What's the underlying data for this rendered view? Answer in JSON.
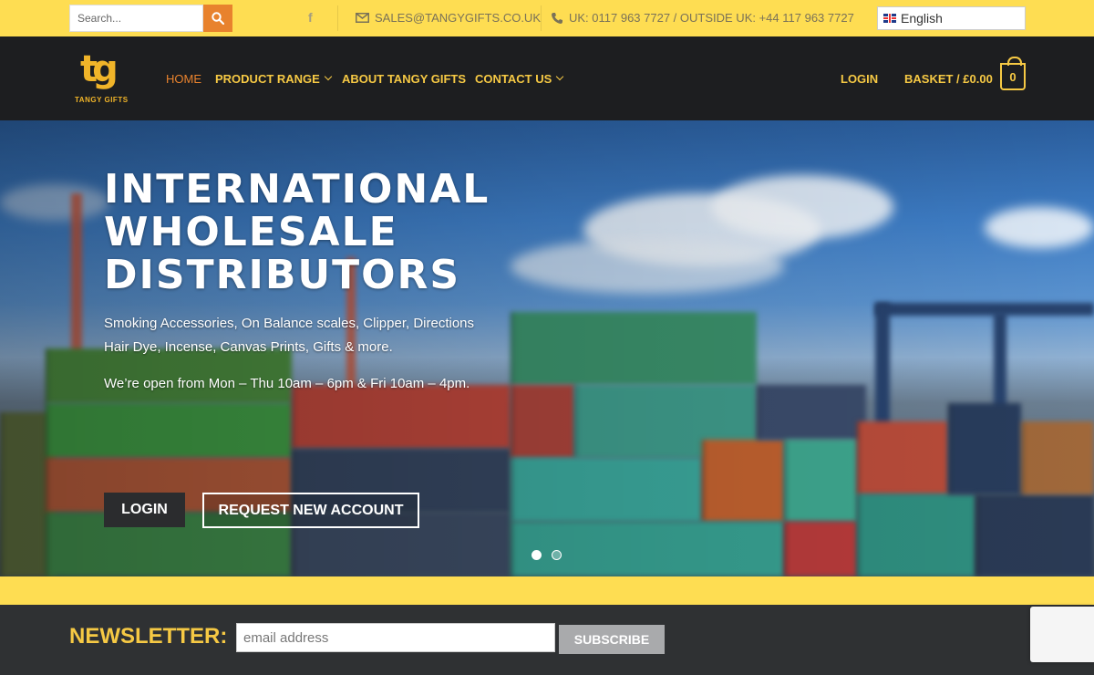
{
  "topbar": {
    "search_placeholder": "Search...",
    "email": "SALES@TANGYGIFTS.CO.UK",
    "phone": "UK: 0117 963 7727 / OUTSIDE UK: +44 117 963 7727",
    "language": "English"
  },
  "header": {
    "logo_text": "TANGY GIFTS",
    "nav": [
      {
        "label": "HOME"
      },
      {
        "label": "PRODUCT RANGE"
      },
      {
        "label": "ABOUT TANGY GIFTS"
      },
      {
        "label": "CONTACT US"
      }
    ],
    "login": "LOGIN",
    "basket": "BASKET / £0.00",
    "basket_count": "0"
  },
  "hero": {
    "title_lines": [
      "INTERNATIONAL",
      "WHOLESALE",
      "DISTRIBUTORS"
    ],
    "subtitle": "Smoking Accessories, On Balance scales, Clipper, Directions Hair Dye, Incense, Canvas Prints, Gifts & more.",
    "hours": "We’re open from Mon – Thu 10am – 6pm & Fri 10am – 4pm.",
    "login_button": "LOGIN",
    "request_button": "REQUEST NEW ACCOUNT"
  },
  "newsletter": {
    "label": "NEWSLETTER:",
    "placeholder": "email address",
    "button": "SUBSCRIBE"
  },
  "colors": {
    "topbar_bg": "#fedd52",
    "header_bg": "#1d1e20",
    "accent_orange": "#e8822d",
    "nav_yellow": "#f6c944"
  }
}
